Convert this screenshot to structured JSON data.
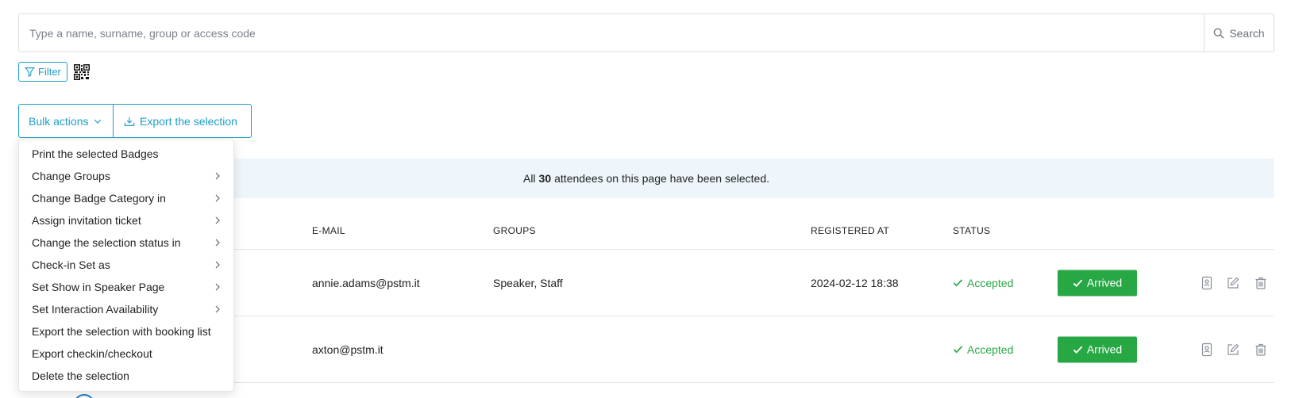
{
  "search": {
    "placeholder": "Type a name, surname, group or access code",
    "button_label": "Search"
  },
  "toolbar": {
    "filter_label": "Filter",
    "bulk_actions_label": "Bulk actions",
    "export_label": "Export the selection"
  },
  "bulk_menu": {
    "items": [
      {
        "label": "Print the selected Badges",
        "submenu": false
      },
      {
        "label": "Change Groups",
        "submenu": true
      },
      {
        "label": "Change Badge Category in",
        "submenu": true
      },
      {
        "label": "Assign invitation ticket",
        "submenu": true
      },
      {
        "label": "Change the selection status in",
        "submenu": true
      },
      {
        "label": "Check-in Set as",
        "submenu": true
      },
      {
        "label": "Set Show in Speaker Page",
        "submenu": true
      },
      {
        "label": "Set Interaction Availability",
        "submenu": true
      },
      {
        "label": "Export the selection with booking list",
        "submenu": false
      },
      {
        "label": "Export checkin/checkout",
        "submenu": false
      },
      {
        "label": "Delete the selection",
        "submenu": false
      }
    ]
  },
  "selection_banner": {
    "prefix": "All",
    "count": "30",
    "suffix": "attendees on this page have been selected."
  },
  "table": {
    "columns": [
      "E-MAIL",
      "GROUPS",
      "REGISTERED AT",
      "STATUS"
    ],
    "rows": [
      {
        "email": "annie.adams@pstm.it",
        "groups": "Speaker, Staff",
        "registered_at": "2024-02-12 18:38",
        "status": "Accepted",
        "checkin": "Arrived"
      },
      {
        "email": "axton@pstm.it",
        "groups": "",
        "registered_at": "",
        "status": "Accepted",
        "checkin": "Arrived"
      }
    ]
  },
  "colors": {
    "accent": "#1e9ec9",
    "success": "#28a745",
    "banner_bg": "#eef6fb"
  }
}
